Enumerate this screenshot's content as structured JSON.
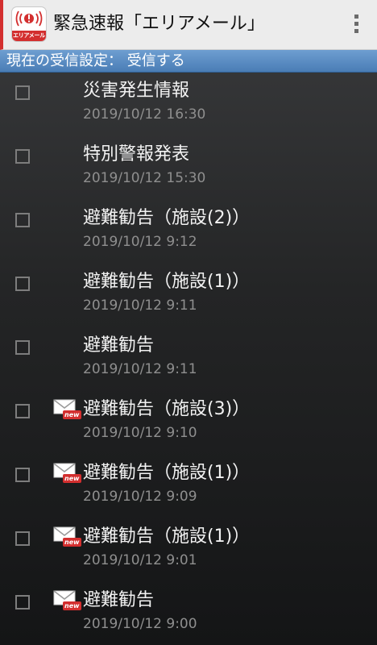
{
  "app_bar": {
    "title": "緊急速報「エリアメール」",
    "icon_label": "エリアメール",
    "accent_color": "#d32f2f"
  },
  "status": {
    "text": "現在の受信設定： 受信する",
    "color": "#5a8dc4"
  },
  "messages": [
    {
      "title": "災害発生情報",
      "date": "2019/10/12 16:30",
      "is_new": false
    },
    {
      "title": "特別警報発表",
      "date": "2019/10/12 15:30",
      "is_new": false
    },
    {
      "title": "避難勧告（施設(2)）",
      "date": "2019/10/12 9:12",
      "is_new": false
    },
    {
      "title": "避難勧告（施設(1)）",
      "date": "2019/10/12 9:11",
      "is_new": false
    },
    {
      "title": "避難勧告",
      "date": "2019/10/12 9:11",
      "is_new": false
    },
    {
      "title": "避難勧告（施設(3)）",
      "date": "2019/10/12 9:10",
      "is_new": true
    },
    {
      "title": "避難勧告（施設(1)）",
      "date": "2019/10/12 9:09",
      "is_new": true
    },
    {
      "title": "避難勧告（施設(1)）",
      "date": "2019/10/12 9:01",
      "is_new": true
    },
    {
      "title": "避難勧告",
      "date": "2019/10/12 9:00",
      "is_new": true
    }
  ],
  "badge": {
    "new_label": "new"
  },
  "icons": {
    "app": "area-mail-icon",
    "menu": "overflow-menu-icon",
    "unread": "mail-new-icon"
  }
}
